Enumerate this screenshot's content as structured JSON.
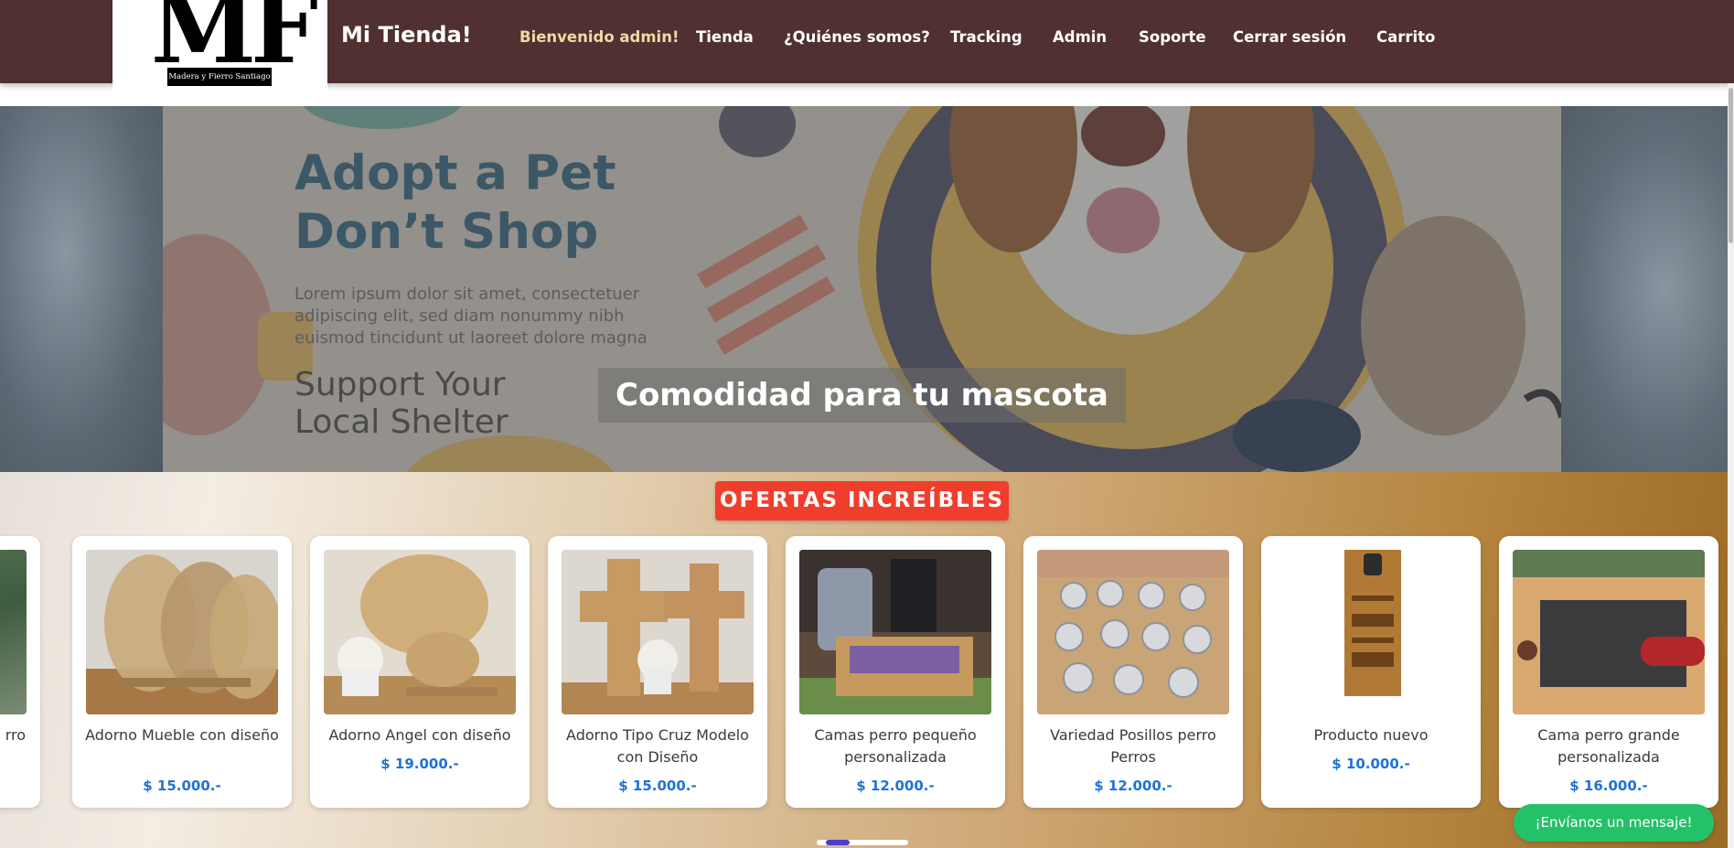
{
  "logo": {
    "letters": "MF",
    "subtitle": "Madera y Fierro Santiago"
  },
  "navbar": {
    "brand": "Mi Tienda!",
    "links": [
      {
        "label": "Bienvenido admin!",
        "active": true
      },
      {
        "label": "Tienda"
      },
      {
        "label": "¿Quiénes somos?"
      },
      {
        "label": "Tracking"
      },
      {
        "label": "Admin"
      },
      {
        "label": "Soporte"
      },
      {
        "label": "Cerrar sesión"
      },
      {
        "label": "Carrito"
      }
    ]
  },
  "hero": {
    "banner_title_line1": "Adopt a Pet",
    "banner_title_line2": "Don’t Shop",
    "banner_body": "Lorem ipsum dolor sit amet, consectetuer adipiscing elit, sed diam nonummy nibh euismod tincidunt ut laoreet dolore magna",
    "banner_subtitle_line1": "Support Your",
    "banner_subtitle_line2": "Local Shelter",
    "caption": "Comodidad para tu mascota"
  },
  "offers": {
    "title": "OFERTAS INCREÍBLES",
    "products": [
      {
        "name": "rro",
        "price": ""
      },
      {
        "name": "Adorno Mueble con diseño",
        "price": "$ 15.000.-"
      },
      {
        "name": "Adorno Angel con diseño",
        "price": "$ 19.000.-"
      },
      {
        "name": "Adorno Tipo Cruz Modelo con Diseño",
        "price": "$ 15.000.-"
      },
      {
        "name": "Camas perro pequeño personalizada",
        "price": "$ 12.000.-"
      },
      {
        "name": "Variedad Posillos perro Perros",
        "price": "$ 12.000.-"
      },
      {
        "name": "Producto nuevo",
        "price": "$ 10.000.-"
      },
      {
        "name": "Cama perro grande personalizada",
        "price": "$ 16.000.-"
      }
    ]
  },
  "chat_button": "¡Envíanos un mensaje!",
  "colors": {
    "navbar": "#503030",
    "active_link": "#f3d9a4",
    "offers_badge": "#f13d2b",
    "price": "#1f72d6",
    "chat_button": "#25c168"
  }
}
